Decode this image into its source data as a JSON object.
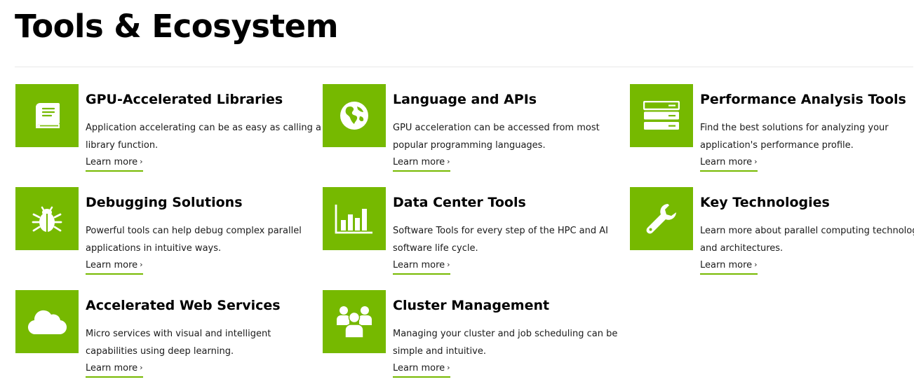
{
  "page": {
    "title": "Tools & Ecosystem",
    "accent_color": "#76b900"
  },
  "cards": [
    {
      "icon": "book-icon",
      "title": "GPU-Accelerated Libraries",
      "description": "Application accelerating can be as easy as calling a library function.",
      "link_label": "Learn more",
      "link_chevron": "›"
    },
    {
      "icon": "globe-icon",
      "title": "Language and APIs",
      "description": "GPU acceleration can be accessed from most popular programming languages.",
      "link_label": "Learn more",
      "link_chevron": "›"
    },
    {
      "icon": "server-icon",
      "title": "Performance Analysis Tools",
      "description": "Find the best solutions for analyzing your application's performance profile.",
      "link_label": "Learn more",
      "link_chevron": "›"
    },
    {
      "icon": "bug-icon",
      "title": "Debugging Solutions",
      "description": "Powerful tools can help debug complex parallel applications in intuitive ways.",
      "link_label": "Learn more",
      "link_chevron": "›"
    },
    {
      "icon": "bar-chart-icon",
      "title": "Data Center Tools",
      "description": "Software Tools for every step of the HPC and AI software life cycle.",
      "link_label": "Learn more",
      "link_chevron": "›"
    },
    {
      "icon": "wrench-icon",
      "title": "Key Technologies",
      "description": "Learn more about parallel computing technologies and architectures.",
      "link_label": "Learn more",
      "link_chevron": "›"
    },
    {
      "icon": "cloud-icon",
      "title": "Accelerated Web Services",
      "description": "Micro services with visual and intelligent capabilities using deep learning.",
      "link_label": "Learn more",
      "link_chevron": "›"
    },
    {
      "icon": "group-icon",
      "title": "Cluster Management",
      "description": "Managing your cluster and job scheduling can be simple and intuitive.",
      "link_label": "Learn more",
      "link_chevron": "›"
    }
  ]
}
